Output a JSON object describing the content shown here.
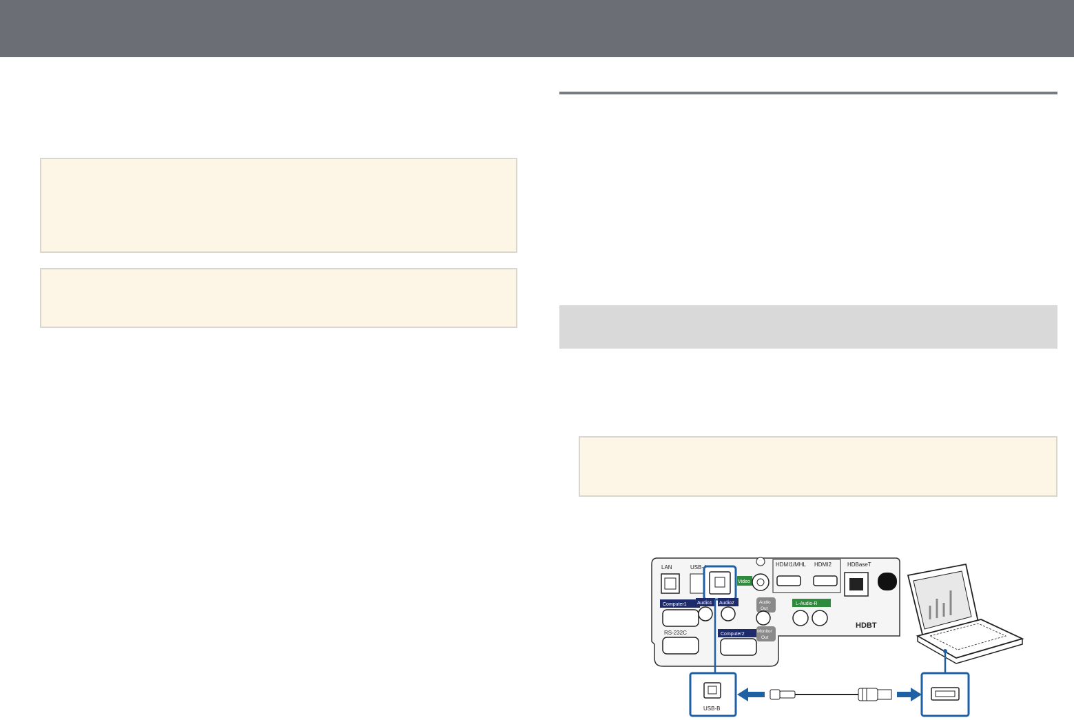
{
  "colors": {
    "header": "#6b6e75",
    "note_bg": "#fdf6e7",
    "section_band": "#d9d9d9",
    "rule": "#777a80",
    "callout_blue": "#1f5fa3",
    "port_navy": "#1e2b6b",
    "port_green": "#2e8b3e",
    "port_gray": "#8a8a8a"
  },
  "diagram": {
    "labels": {
      "lan": "LAN",
      "usb_a": "USB-A",
      "video": "Video",
      "hdmi1": "HDMI1/MHL",
      "hdmi2": "HDMI2",
      "hdbaset": "HDBaseT",
      "computer1": "Computer1",
      "audio1": "Audio1",
      "audio2": "Audio2",
      "audio_out_1": "Audio",
      "audio_out_2": "Out",
      "l_audio_r": "L-Audio-R",
      "rs232c": "RS-232C",
      "computer2": "Computer2",
      "monitor_out_1": "Monitor",
      "monitor_out_2": "Out",
      "hdbt_logo": "HDBT",
      "usb_b": "USB-B"
    },
    "icons": [
      "usb-b-port-icon",
      "usb-a-port-icon",
      "laptop-icon",
      "usb-cable-icon",
      "arrow-left-icon",
      "arrow-right-icon"
    ]
  }
}
